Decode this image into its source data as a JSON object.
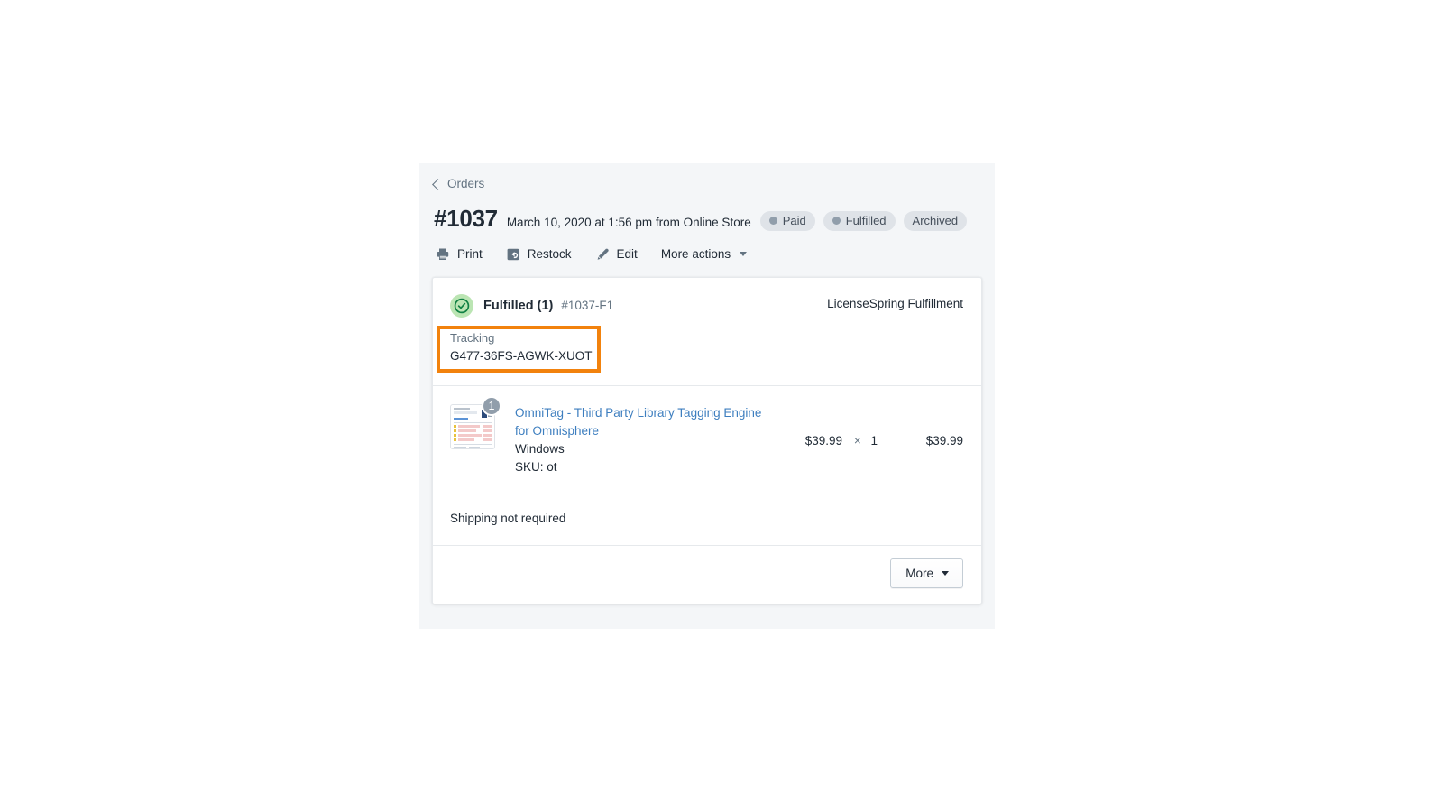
{
  "breadcrumb": {
    "label": "Orders",
    "icon": "chevron-left-icon"
  },
  "order": {
    "number": "#1037",
    "meta": "March 10, 2020 at 1:56 pm from Online Store",
    "badges": [
      {
        "label": "Paid",
        "dot": true
      },
      {
        "label": "Fulfilled",
        "dot": true
      },
      {
        "label": "Archived",
        "dot": false
      }
    ]
  },
  "actions": [
    {
      "label": "Print",
      "icon": "printer-icon"
    },
    {
      "label": "Restock",
      "icon": "restock-arrow-icon"
    },
    {
      "label": "Edit",
      "icon": "pencil-icon"
    },
    {
      "label": "More actions",
      "icon": "chevron-down-icon"
    }
  ],
  "fulfillment": {
    "status_icon": "check-circle-icon",
    "status_label": "Fulfilled",
    "status_count": "(1)",
    "fulfillment_id": "#1037-F1",
    "service": "LicenseSpring Fulfillment",
    "tracking_label": "Tracking",
    "tracking_number": "G477-36FS-AGWK-XUOT",
    "highlight_color": "#f2820d"
  },
  "line_item": {
    "quantity_badge": "1",
    "title": "OmniTag - Third Party Library Tagging Engine for Omnisphere",
    "variant": "Windows",
    "sku": "SKU: ot",
    "unit_price": "$39.99",
    "times_symbol": "×",
    "quantity": "1",
    "line_total": "$39.99"
  },
  "shipping": {
    "note": "Shipping not required"
  },
  "footer": {
    "more_button": "More",
    "more_caret": "chevron-down-icon"
  }
}
